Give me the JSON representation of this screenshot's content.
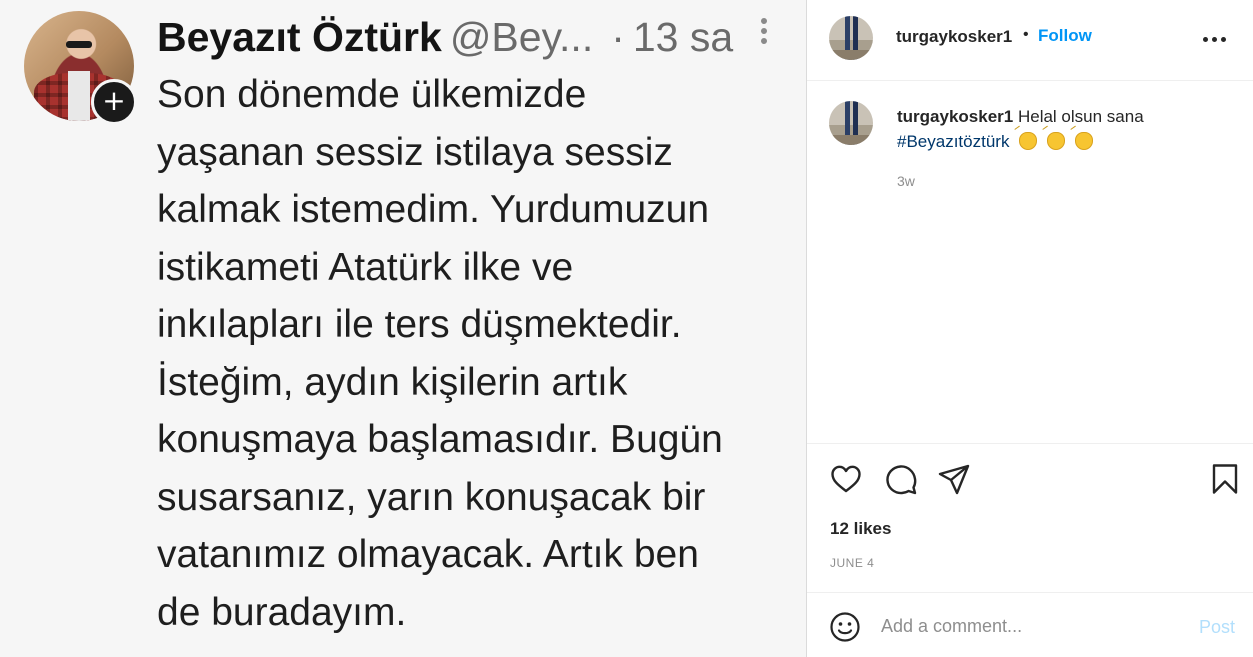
{
  "tweet": {
    "name": "Beyazıt Öztürk",
    "handle": "@Bey...",
    "dot": "·",
    "time": "13 sa",
    "plus_symbol": "+",
    "lines": [
      "Son dönemde ülkemizde",
      "yaşanan sessiz istilaya sessiz",
      "kalmak istemedim. Yurdumuzun",
      "istikameti Atatürk ilke ve",
      "inkılapları ile ters düşmektedir.",
      "İsteğim, aydın kişilerin artık",
      "konuşmaya başlamasıdır. Bugün",
      "susarsanız, yarın konuşacak bir",
      "vatanımız olmayacak. Artık ben",
      "de buradayım."
    ]
  },
  "header": {
    "username": "turgaykosker1",
    "separator": "•",
    "follow_label": "Follow",
    "more_icon": "more-horizontal-icon"
  },
  "caption": {
    "username": "turgaykosker1",
    "text": "Helal olsun sana",
    "hashtag": "#Beyazıtöztürk",
    "emoji": "clapping-hands",
    "age": "3w"
  },
  "actions": {
    "icons": [
      "heart-icon",
      "comment-icon",
      "share-icon",
      "bookmark-icon"
    ]
  },
  "likes_text": "12 likes",
  "date": "JUNE 4",
  "comment": {
    "placeholder": "Add a comment...",
    "post_label": "Post"
  },
  "colors": {
    "follow": "#0095f6",
    "post_disabled": "#b2dffc",
    "hashtag": "#00376b",
    "muted": "#8e8e8e"
  }
}
